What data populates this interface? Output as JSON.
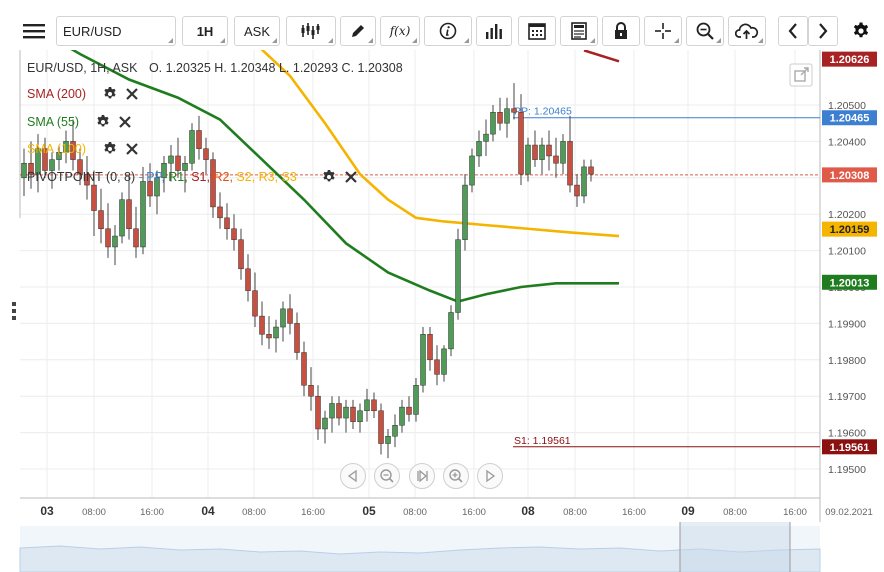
{
  "toolbar": {
    "symbol": "EUR/USD",
    "timeframe": "1H",
    "price_type": "ASK",
    "function_label": "f(x)"
  },
  "chart_data": {
    "type": "candlestick",
    "title": "EUR/USD, 1H, ASK",
    "ohlc_header": {
      "O": "1.20325",
      "H": "1.20348",
      "L": "1.20293",
      "C": "1.20308"
    },
    "y_ticks": [
      "1.20500",
      "1.20400",
      "1.20300",
      "1.20200",
      "1.20100",
      "1.20000",
      "1.19900",
      "1.19800",
      "1.19700",
      "1.19600",
      "1.19500"
    ],
    "x_ticks": [
      "03",
      "08:00",
      "16:00",
      "04",
      "08:00",
      "16:00",
      "05",
      "08:00",
      "16:00",
      "08",
      "08:00",
      "16:00",
      "09",
      "08:00",
      "16:00",
      "09.02.2021"
    ],
    "ylim": [
      1.1945,
      1.2065
    ],
    "candles": [
      [
        1.203,
        1.2038,
        1.2025,
        1.2034
      ],
      [
        1.2034,
        1.204,
        1.2027,
        1.2031
      ],
      [
        1.2031,
        1.2042,
        1.2026,
        1.2038
      ],
      [
        1.2038,
        1.2041,
        1.203,
        1.2032
      ],
      [
        1.2032,
        1.2037,
        1.2027,
        1.2035
      ],
      [
        1.2035,
        1.2039,
        1.2032,
        1.2037
      ],
      [
        1.2037,
        1.2043,
        1.2034,
        1.204
      ],
      [
        1.204,
        1.2046,
        1.2032,
        1.2035
      ],
      [
        1.2035,
        1.2038,
        1.2028,
        1.2031
      ],
      [
        1.2031,
        1.2036,
        1.2024,
        1.2028
      ],
      [
        1.2028,
        1.2032,
        1.2014,
        1.2021
      ],
      [
        1.2021,
        1.2027,
        1.2012,
        1.2016
      ],
      [
        1.2016,
        1.2023,
        1.2008,
        1.2011
      ],
      [
        1.2011,
        1.2017,
        1.2006,
        1.2014
      ],
      [
        1.2014,
        1.2026,
        1.2012,
        1.2024
      ],
      [
        1.2024,
        1.2031,
        1.2013,
        1.2016
      ],
      [
        1.2016,
        1.2022,
        1.2008,
        1.2011
      ],
      [
        1.2011,
        1.2033,
        1.2009,
        1.2029
      ],
      [
        1.2029,
        1.2034,
        1.2022,
        1.2025
      ],
      [
        1.2025,
        1.2032,
        1.202,
        1.203
      ],
      [
        1.203,
        1.2036,
        1.2026,
        1.2034
      ],
      [
        1.2034,
        1.2039,
        1.2029,
        1.2036
      ],
      [
        1.2036,
        1.2041,
        1.203,
        1.2032
      ],
      [
        1.2032,
        1.2036,
        1.2026,
        1.2034
      ],
      [
        1.2034,
        1.2045,
        1.2032,
        1.2043
      ],
      [
        1.2043,
        1.2047,
        1.2035,
        1.2038
      ],
      [
        1.2038,
        1.2041,
        1.2031,
        1.2035
      ],
      [
        1.2035,
        1.2037,
        1.2019,
        1.2022
      ],
      [
        1.2022,
        1.2026,
        1.2016,
        1.2019
      ],
      [
        1.2019,
        1.2023,
        1.2013,
        1.2016
      ],
      [
        1.2016,
        1.202,
        1.201,
        1.2013
      ],
      [
        1.2013,
        1.2016,
        1.2002,
        1.2005
      ],
      [
        1.2005,
        1.2009,
        1.1996,
        1.1999
      ],
      [
        1.1999,
        1.2004,
        1.1989,
        1.1992
      ],
      [
        1.1992,
        1.1996,
        1.1984,
        1.1987
      ],
      [
        1.1987,
        1.1992,
        1.1983,
        1.1986
      ],
      [
        1.1986,
        1.1991,
        1.1982,
        1.1989
      ],
      [
        1.1989,
        1.1996,
        1.1985,
        1.1994
      ],
      [
        1.1994,
        1.1998,
        1.1987,
        1.199
      ],
      [
        1.199,
        1.1993,
        1.198,
        1.1982
      ],
      [
        1.1982,
        1.1985,
        1.197,
        1.1973
      ],
      [
        1.1973,
        1.1978,
        1.1966,
        1.197
      ],
      [
        1.197,
        1.1973,
        1.1958,
        1.1961
      ],
      [
        1.1961,
        1.1966,
        1.1957,
        1.1964
      ],
      [
        1.1964,
        1.197,
        1.196,
        1.1968
      ],
      [
        1.1968,
        1.197,
        1.1962,
        1.1964
      ],
      [
        1.1964,
        1.1969,
        1.196,
        1.1967
      ],
      [
        1.1967,
        1.1969,
        1.1961,
        1.1963
      ],
      [
        1.1963,
        1.1968,
        1.196,
        1.1966
      ],
      [
        1.1966,
        1.1972,
        1.1963,
        1.1969
      ],
      [
        1.1969,
        1.1971,
        1.1964,
        1.1966
      ],
      [
        1.1966,
        1.1968,
        1.1954,
        1.1957
      ],
      [
        1.1957,
        1.1961,
        1.1953,
        1.1959
      ],
      [
        1.1959,
        1.1965,
        1.1956,
        1.1962
      ],
      [
        1.1962,
        1.1969,
        1.196,
        1.1967
      ],
      [
        1.1967,
        1.197,
        1.1963,
        1.1965
      ],
      [
        1.1965,
        1.1975,
        1.1963,
        1.1973
      ],
      [
        1.1973,
        1.1989,
        1.1971,
        1.1987
      ],
      [
        1.1987,
        1.1989,
        1.1977,
        1.198
      ],
      [
        1.198,
        1.1984,
        1.1973,
        1.1976
      ],
      [
        1.1976,
        1.1984,
        1.1974,
        1.1983
      ],
      [
        1.1983,
        1.1995,
        1.1981,
        1.1993
      ],
      [
        1.1993,
        1.2016,
        1.1991,
        1.2013
      ],
      [
        1.2013,
        1.2031,
        1.201,
        1.2028
      ],
      [
        1.2028,
        1.2038,
        1.2026,
        1.2036
      ],
      [
        1.2036,
        1.2043,
        1.2033,
        1.204
      ],
      [
        1.204,
        1.2046,
        1.2036,
        1.2042
      ],
      [
        1.2042,
        1.205,
        1.204,
        1.2048
      ],
      [
        1.2048,
        1.2052,
        1.2043,
        1.2045
      ],
      [
        1.2045,
        1.2052,
        1.2041,
        1.2049
      ],
      [
        1.2049,
        1.2056,
        1.2046,
        1.2048
      ],
      [
        1.2048,
        1.2053,
        1.2028,
        1.2031
      ],
      [
        1.2031,
        1.2041,
        1.2029,
        1.2039
      ],
      [
        1.2039,
        1.2043,
        1.2033,
        1.2035
      ],
      [
        1.2035,
        1.2041,
        1.2031,
        1.2039
      ],
      [
        1.2039,
        1.2043,
        1.2032,
        1.2036
      ],
      [
        1.2036,
        1.2041,
        1.203,
        1.2034
      ],
      [
        1.2034,
        1.2042,
        1.2031,
        1.204
      ],
      [
        1.204,
        1.2047,
        1.2026,
        1.2028
      ],
      [
        1.2028,
        1.2031,
        1.2022,
        1.2025
      ],
      [
        1.2025,
        1.2035,
        1.2023,
        1.2033
      ],
      [
        1.2033,
        1.2035,
        1.2029,
        1.2031
      ]
    ],
    "sma200": {
      "name": "SMA (200)",
      "color": "#a72222",
      "points": [
        [
          80,
          1.2065
        ],
        [
          85,
          1.2062
        ]
      ]
    },
    "sma55": {
      "name": "SMA (55)",
      "color": "#1f7d1f",
      "points": [
        [
          0,
          1.2073
        ],
        [
          8,
          1.2064
        ],
        [
          15,
          1.2057
        ],
        [
          22,
          1.2052
        ],
        [
          28,
          1.2046
        ],
        [
          34,
          1.2035
        ],
        [
          40,
          1.2024
        ],
        [
          46,
          1.2012
        ],
        [
          52,
          1.2004
        ],
        [
          58,
          1.1999
        ],
        [
          62,
          1.1996
        ],
        [
          66,
          1.1998
        ],
        [
          71,
          1.2
        ],
        [
          76,
          1.2001
        ],
        [
          85,
          1.2001
        ]
      ]
    },
    "sma100": {
      "name": "SMA (100)",
      "color": "#f5b400",
      "points": [
        [
          33,
          1.2067
        ],
        [
          38,
          1.2058
        ],
        [
          43,
          1.2045
        ],
        [
          48,
          1.2031
        ],
        [
          52,
          1.2024
        ],
        [
          56,
          1.2019
        ],
        [
          60,
          1.2018
        ],
        [
          66,
          1.2017
        ],
        [
          72,
          1.2016
        ],
        [
          78,
          1.2015
        ],
        [
          85,
          1.2014
        ]
      ]
    },
    "pivot_label": "PIVOTPOINT (0, 8)",
    "pivot_levels": [
      "PP,",
      "R1,",
      "S1,",
      "R2,",
      "S2,",
      "R3,",
      "S3"
    ],
    "pivot_colors": [
      "#3d7fd1",
      "#1f7d1f",
      "#a72222",
      "#e05010",
      "#f5b400",
      "#f5b400",
      "#f5b400"
    ],
    "pp_line": {
      "label": "PP: 1.20465",
      "value": 1.20465,
      "price": "1.20465",
      "color": "#3d7fd1"
    },
    "s1_line": {
      "label": "S1: 1.19561",
      "value": 1.19561,
      "price": "1.19561",
      "color": "#8b1010"
    },
    "current_price": {
      "value": 1.20308,
      "price": "1.20308",
      "color": "#e05a4a"
    },
    "sma_price_tags": [
      {
        "price": "1.20626",
        "value": 1.20626,
        "color": "#a72222"
      },
      {
        "price": "1.20159",
        "value": 1.20159,
        "color": "#f5b400"
      },
      {
        "price": "1.20013",
        "value": 1.20013,
        "color": "#1f7d1f"
      }
    ]
  }
}
